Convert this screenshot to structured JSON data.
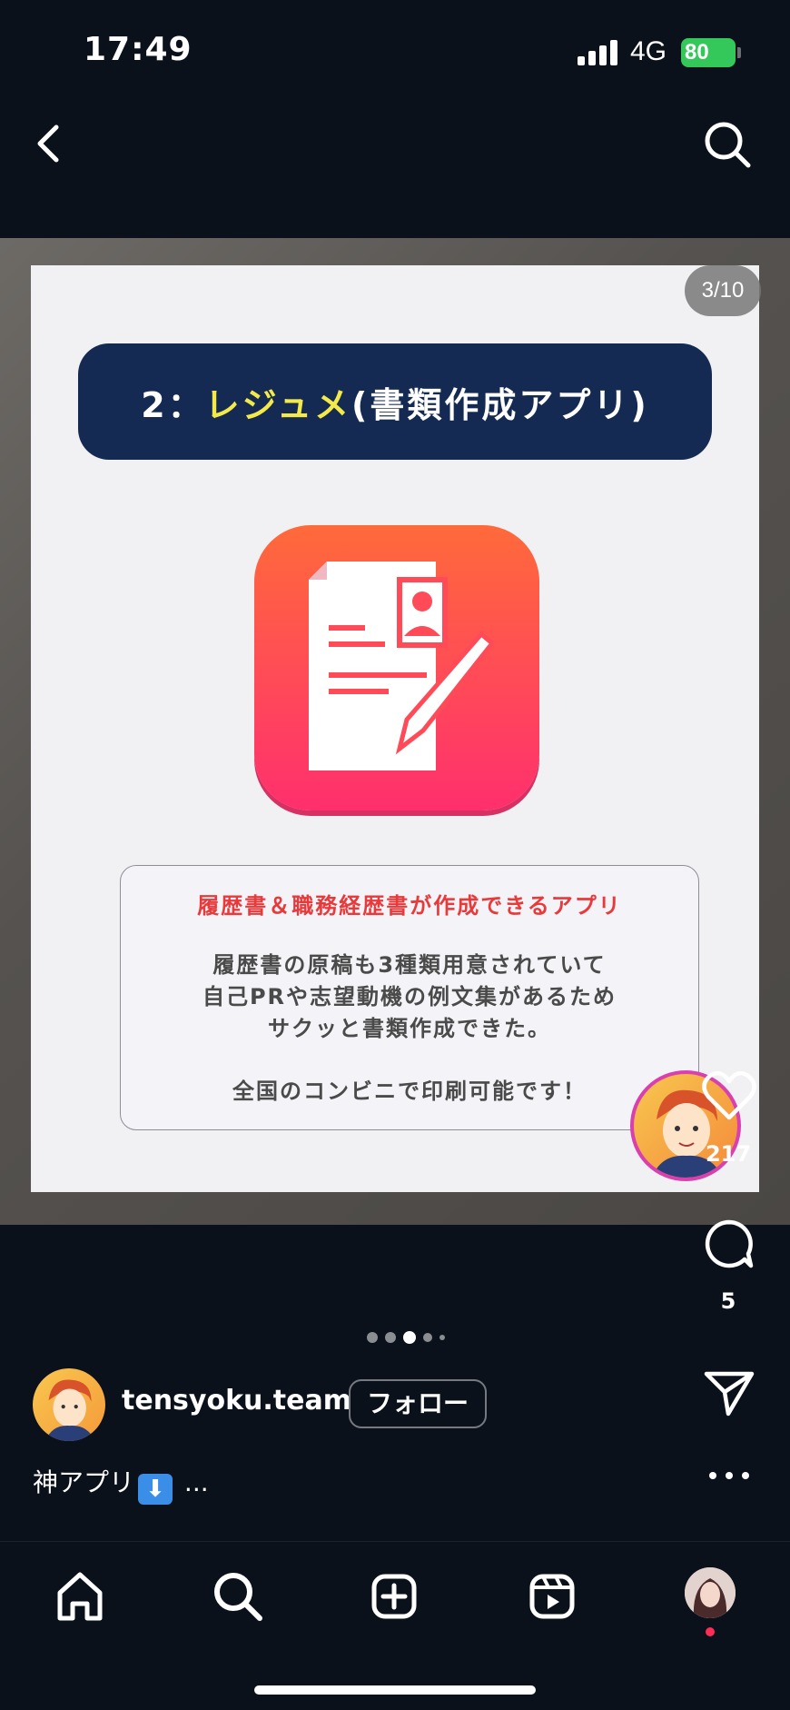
{
  "status_bar": {
    "time": "17:49",
    "network": "4G",
    "battery": "80"
  },
  "post": {
    "page_counter": "3/10",
    "card": {
      "title_prefix": "2：",
      "title_accent": "レジュメ",
      "title_suffix": "(書類作成アプリ)",
      "headline": "履歴書＆職務経歴書が作成できるアプリ",
      "lines": [
        "履歴書の原稿も3種類用意されていて",
        "自己PRや志望動機の例文集があるため",
        "サクッと書類作成できた。"
      ],
      "footer": "全国のコンビニで印刷可能です！"
    }
  },
  "actions": {
    "likes": "217",
    "comments": "5"
  },
  "carousel": {
    "count": 5,
    "active_index": 2
  },
  "profile": {
    "username": "tensyoku.team",
    "follow_label": "フォロー"
  },
  "caption": {
    "text_before": "神アプリ",
    "emoji": "⬇",
    "text_after": " ..."
  },
  "colors": {
    "accent_yellow": "#f3ea4a",
    "title_bar": "#152a52",
    "headline_red": "#e8393b",
    "battery_green": "#34c759"
  }
}
